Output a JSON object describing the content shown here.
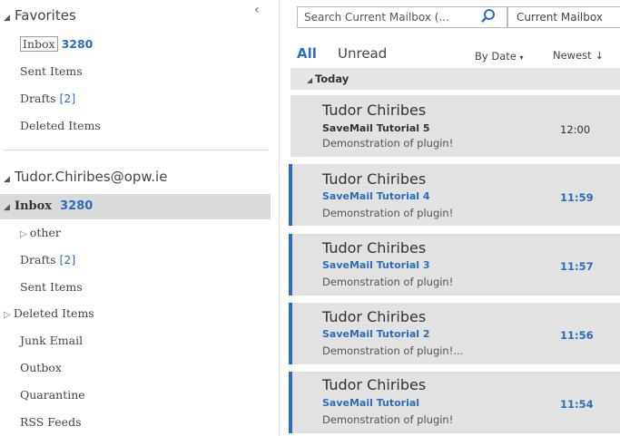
{
  "favorites": {
    "header": "Favorites",
    "items": [
      {
        "label": "Inbox",
        "count": "3280"
      },
      {
        "label": "Sent Items"
      },
      {
        "label": "Drafts",
        "count": "[2]"
      },
      {
        "label": "Deleted Items"
      }
    ]
  },
  "account": {
    "name": "Tudor.Chiribes@opw.ie",
    "inbox": {
      "label": "Inbox",
      "count": "3280"
    },
    "folders": [
      {
        "label": "other",
        "expandable": true
      },
      {
        "label": "Drafts",
        "count": "[2]"
      },
      {
        "label": "Sent Items"
      },
      {
        "label": "Deleted Items",
        "expandable": true
      },
      {
        "label": "Junk Email"
      },
      {
        "label": "Outbox"
      },
      {
        "label": "Quarantine"
      },
      {
        "label": "RSS Feeds"
      }
    ]
  },
  "search": {
    "placeholder": "Search Current Mailbox (...",
    "scope": "Current Mailbox"
  },
  "filters": {
    "all": "All",
    "unread": "Unread",
    "sort_by": "By Date",
    "order": "Newest"
  },
  "group_label": "Today",
  "messages": [
    {
      "sender": "Tudor Chiribes",
      "subject": "SaveMail Tutorial 5",
      "preview": "Demonstration of plugin!",
      "time": "12:00",
      "unread": false
    },
    {
      "sender": "Tudor Chiribes",
      "subject": "SaveMail Tutorial 4",
      "preview": "Demonstration of plugin!",
      "time": "11:59",
      "unread": true
    },
    {
      "sender": "Tudor Chiribes",
      "subject": "SaveMail Tutorial 3",
      "preview": "Demonstration of plugin!",
      "time": "11:57",
      "unread": true
    },
    {
      "sender": "Tudor Chiribes",
      "subject": "SaveMail Tutorial 2",
      "preview": "Demonstration of plugin!...",
      "time": "11:56",
      "unread": true
    },
    {
      "sender": "Tudor Chiribes",
      "subject": "SaveMail Tutorial",
      "preview": "Demonstration of plugin!",
      "time": "11:54",
      "unread": true
    }
  ],
  "colors": {
    "accent": "#2a6ebb",
    "selected": "#dadada",
    "message_bg": "#e2e2e2"
  }
}
